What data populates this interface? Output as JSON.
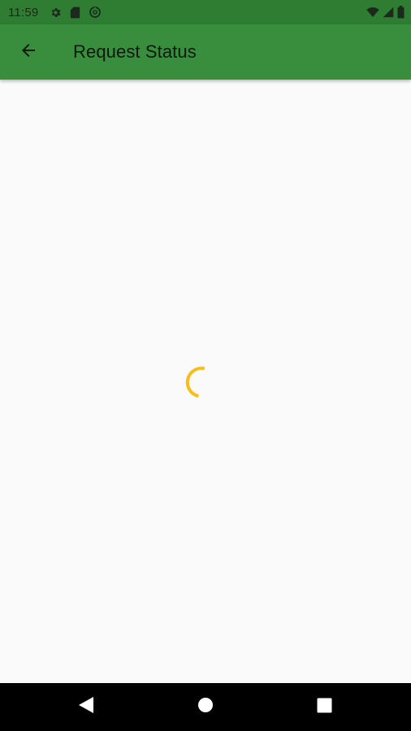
{
  "status_bar": {
    "time": "11:59",
    "left_icons": [
      "settings-icon",
      "sim-card-icon",
      "data-saver-icon"
    ],
    "right_icons": [
      "wifi-icon",
      "cell-signal-icon",
      "battery-icon"
    ]
  },
  "app_bar": {
    "title": "Request Status",
    "back_icon": "arrow-back-icon"
  },
  "content": {
    "loading": true,
    "spinner_color": "#f9bd1b"
  },
  "nav_bar": {
    "buttons": [
      "back-triangle-icon",
      "home-circle-icon",
      "recents-square-icon"
    ]
  },
  "colors": {
    "status_bar": "#2e7d32",
    "app_bar": "#388e3c",
    "background": "#fafafa",
    "nav_bar": "#000000",
    "accent": "#f9bd1b"
  }
}
